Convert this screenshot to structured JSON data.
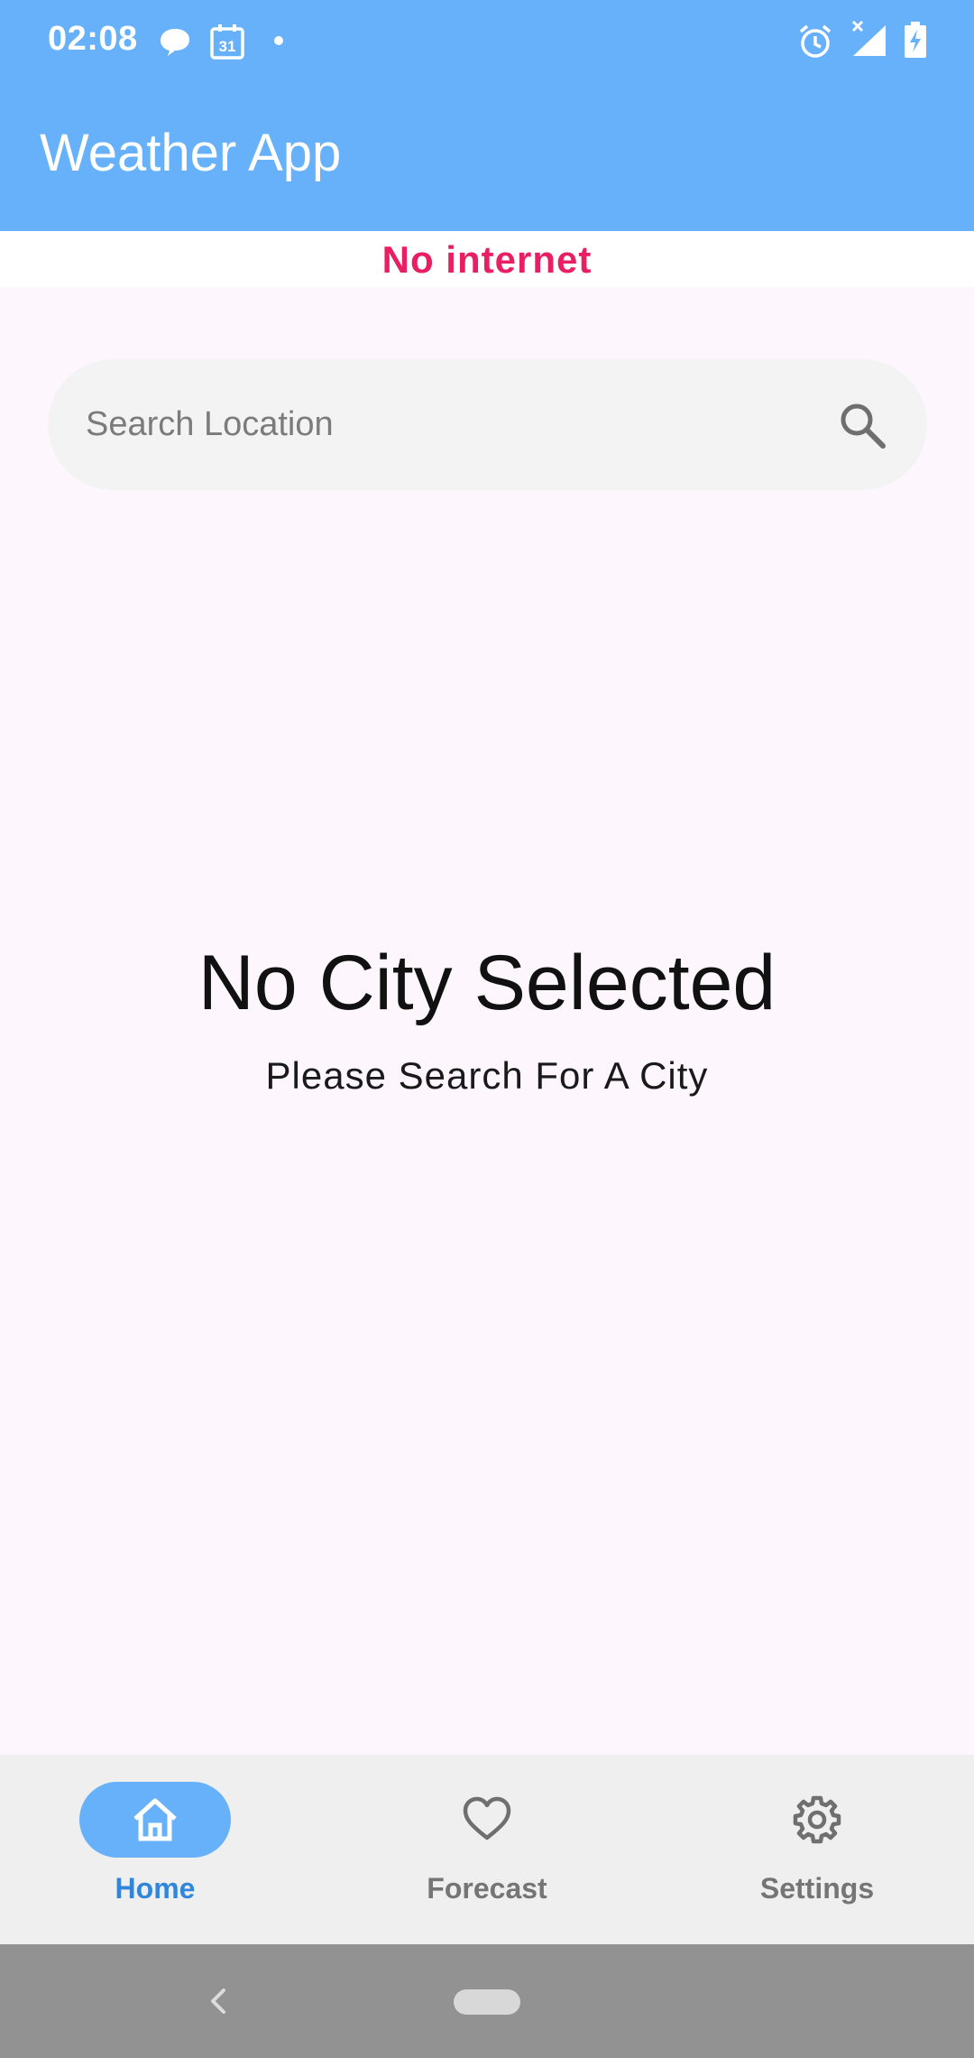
{
  "status_bar": {
    "time": "02:08",
    "icons": [
      "chat-bubble-icon",
      "calendar-icon",
      "notification-dot-icon",
      "alarm-icon",
      "no-signal-icon",
      "battery-charging-icon"
    ],
    "calendar_day": "31"
  },
  "app_bar": {
    "title": "Weather App"
  },
  "banner": {
    "text": "No internet",
    "color": "#e91e63"
  },
  "search": {
    "placeholder": "Search Location",
    "value": "",
    "icon": "search-icon"
  },
  "empty_state": {
    "title": "No City Selected",
    "subtitle": "Please Search For A City"
  },
  "bottom_nav": {
    "items": [
      {
        "label": "Home",
        "icon": "home-icon",
        "active": true
      },
      {
        "label": "Forecast",
        "icon": "heart-icon",
        "active": false
      },
      {
        "label": "Settings",
        "icon": "gear-icon",
        "active": false
      }
    ]
  },
  "colors": {
    "primary": "#66b1fa",
    "active_label": "#2f86dc",
    "background": "#fdf6fd"
  },
  "system_nav": {
    "icons": [
      "back-icon",
      "home-pill-icon"
    ]
  }
}
